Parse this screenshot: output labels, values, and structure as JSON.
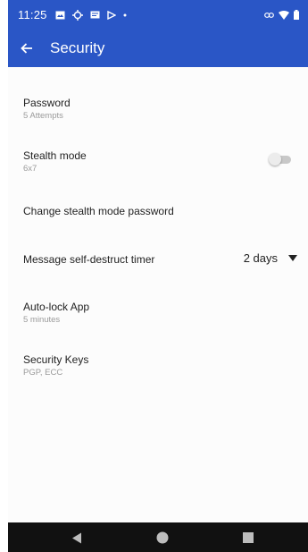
{
  "status_bar": {
    "time": "11:25",
    "left_icons": [
      "image-icon",
      "location-icon",
      "message-icon",
      "play-icon",
      "dot-icon"
    ],
    "right_icons": [
      "link-icon",
      "wifi-icon",
      "battery-icon"
    ]
  },
  "app_bar": {
    "title": "Security",
    "back_icon": "arrow-back-icon",
    "color": "#2a56c6"
  },
  "settings": [
    {
      "title": "Password",
      "subtitle": "5 Attempts"
    },
    {
      "title": "Stealth mode",
      "subtitle": "6x7",
      "toggle_on": false
    },
    {
      "title": "Change stealth mode password"
    },
    {
      "title": "Message self-destruct timer",
      "value": "2 days"
    },
    {
      "title": "Auto-lock App",
      "subtitle": "5 minutes"
    },
    {
      "title": "Security Keys",
      "subtitle": "PGP, ECC"
    }
  ],
  "nav_bar": {
    "icons": [
      "back-triangle-icon",
      "home-circle-icon",
      "recents-square-icon"
    ]
  }
}
